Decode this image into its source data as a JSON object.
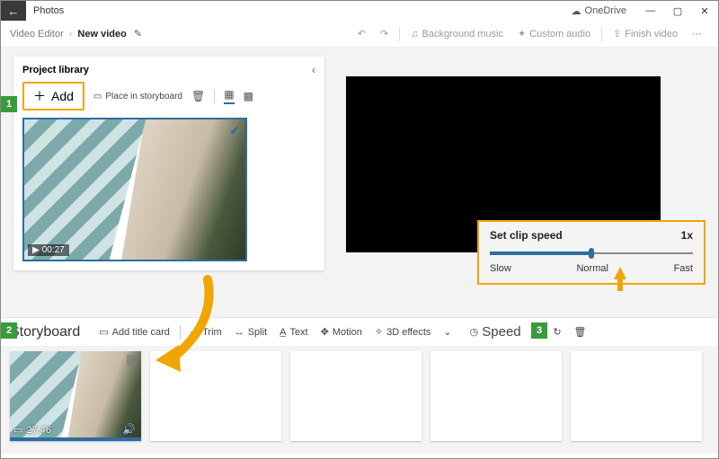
{
  "titlebar": {
    "app_name": "Photos",
    "onedrive": "OneDrive"
  },
  "breadcrumb": {
    "root": "Video Editor",
    "current": "New video"
  },
  "commands": {
    "bg_music": "Background music",
    "custom_audio": "Custom audio",
    "finish": "Finish video"
  },
  "library": {
    "title": "Project library",
    "add_label": "Add",
    "place_label": "Place in storyboard",
    "thumb_duration": "00:27"
  },
  "speed_popup": {
    "title": "Set clip speed",
    "value": "1x",
    "slow": "Slow",
    "normal": "Normal",
    "fast": "Fast"
  },
  "storyboard": {
    "title": "Storyboard",
    "add_title_card": "Add title card",
    "trim": "Trim",
    "split": "Split",
    "text": "Text",
    "motion": "Motion",
    "effects": "3D effects",
    "speed": "Speed",
    "clip_duration": "27.46"
  },
  "annotations": {
    "one": "1",
    "two": "2",
    "three": "3"
  }
}
